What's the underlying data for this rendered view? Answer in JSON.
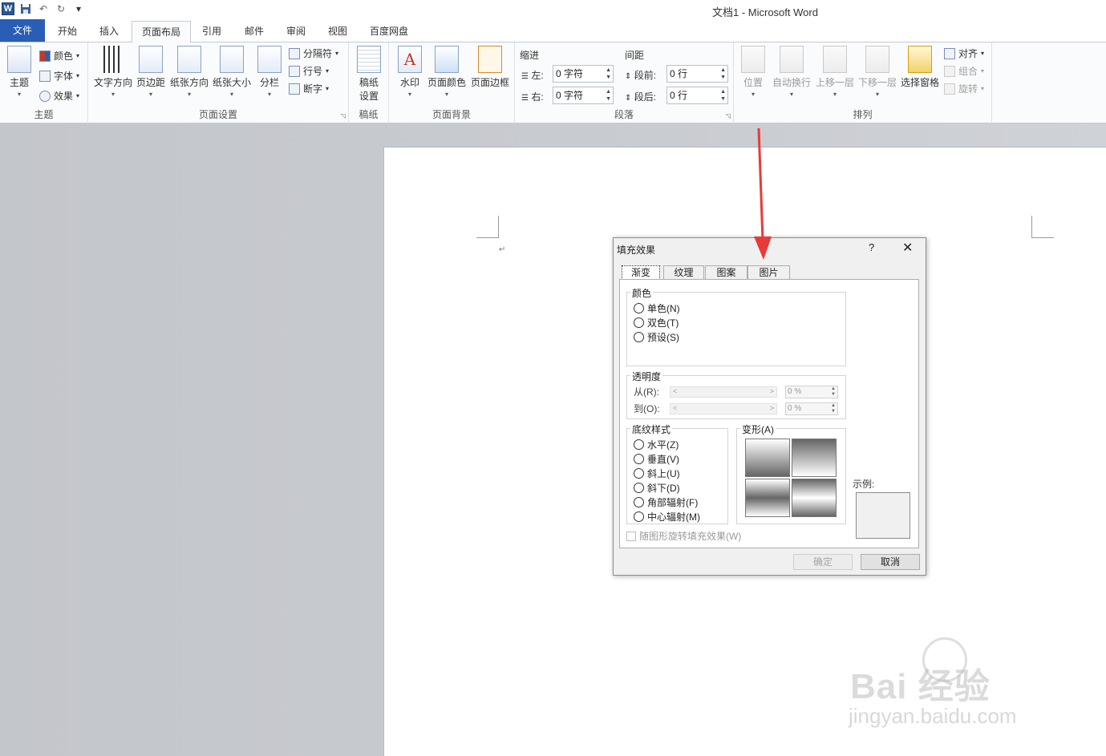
{
  "window": {
    "title": "文档1  -  Microsoft Word"
  },
  "qat": {
    "app_icon": "W",
    "undo_icon": "undo-icon",
    "redo_icon": "redo-icon",
    "customize": "▾"
  },
  "tabs": [
    {
      "label": "文件"
    },
    {
      "label": "开始"
    },
    {
      "label": "插入"
    },
    {
      "label": "页面布局"
    },
    {
      "label": "引用"
    },
    {
      "label": "邮件"
    },
    {
      "label": "审阅"
    },
    {
      "label": "视图"
    },
    {
      "label": "百度网盘"
    }
  ],
  "ribbon": {
    "theme": {
      "label": "主题",
      "big": "主题",
      "colors": "颜色",
      "fonts": "字体",
      "effects": "效果"
    },
    "page_setup": {
      "label": "页面设置",
      "text_dir": "文字方向",
      "margins": "页边距",
      "orientation": "纸张方向",
      "size": "纸张大小",
      "columns": "分栏",
      "breaks": "分隔符",
      "line_numbers": "行号",
      "hyphenation": "断字"
    },
    "manuscript": {
      "label": "稿纸",
      "setup_1": "稿纸",
      "setup_2": "设置"
    },
    "page_background": {
      "label": "页面背景",
      "watermark": "水印",
      "page_color": "页面颜色",
      "page_borders": "页面边框"
    },
    "paragraph": {
      "label": "段落",
      "indent_title": "缩进",
      "spacing_title": "间距",
      "left_label": "左:",
      "left_value": "0 字符",
      "right_label": "右:",
      "right_value": "0 字符",
      "before_label": "段前:",
      "before_value": "0 行",
      "after_label": "段后:",
      "after_value": "0 行"
    },
    "arrange": {
      "label": "排列",
      "position": "位置",
      "wrap": "自动换行",
      "forward": "上移一层",
      "backward": "下移一层",
      "selection_pane": "选择窗格",
      "align": "对齐",
      "group": "组合",
      "rotate": "旋转"
    }
  },
  "document": {
    "paragraph_mark": "↵"
  },
  "dialog": {
    "title": "填充效果",
    "help": "?",
    "close": "✕",
    "tabs": [
      {
        "label": "渐变"
      },
      {
        "label": "纹理"
      },
      {
        "label": "图案"
      },
      {
        "label": "图片"
      }
    ],
    "colors": {
      "title": "颜色",
      "one": "单色(N)",
      "two": "双色(T)",
      "preset": "预设(S)"
    },
    "transparency": {
      "title": "透明度",
      "from_label": "从(R):",
      "to_label": "到(O):",
      "from_value": "0 %",
      "to_value": "0 %"
    },
    "shading": {
      "title": "底纹样式",
      "horizontal": "水平(Z)",
      "vertical": "垂直(V)",
      "diag_up": "斜上(U)",
      "diag_down": "斜下(D)",
      "from_corner": "角部辐射(F)",
      "from_center": "中心辐射(M)"
    },
    "variants": {
      "title": "变形(A)"
    },
    "rotate": "随图形旋转填充效果(W)",
    "sample": "示例:",
    "ok": "确定",
    "cancel": "取消"
  },
  "watermark": {
    "brand": "Bai  经验",
    "url": "jingyan.baidu.com"
  },
  "colors": {
    "accent": "#2a5db5",
    "arrow": "#e83a3a"
  }
}
